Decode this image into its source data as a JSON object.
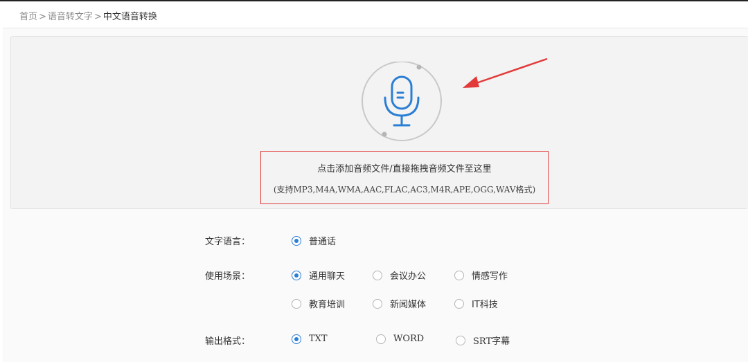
{
  "breadcrumb": {
    "items": [
      "首页",
      "语音转文字"
    ],
    "separator": ">",
    "current": "中文语音转换"
  },
  "upload": {
    "icon": "microphone-icon",
    "hint_main": "点击添加音频文件/直接拖拽音频文件至这里",
    "hint_formats": "(支持MP3,M4A,WMA,AAC,FLAC,AC3,M4R,APE,OGG,WAV格式)"
  },
  "form": {
    "language": {
      "label": "文字语言：",
      "options": [
        {
          "label": "普通话",
          "checked": true
        }
      ]
    },
    "scene": {
      "label": "使用场景：",
      "options": [
        {
          "label": "通用聊天",
          "checked": true
        },
        {
          "label": "会议办公",
          "checked": false
        },
        {
          "label": "情感写作",
          "checked": false
        },
        {
          "label": "教育培训",
          "checked": false
        },
        {
          "label": "新闻媒体",
          "checked": false
        },
        {
          "label": "IT科技",
          "checked": false
        }
      ]
    },
    "output": {
      "label": "输出格式：",
      "options": [
        {
          "label": "TXT",
          "checked": true
        },
        {
          "label": "WORD",
          "checked": false
        },
        {
          "label": "SRT字幕",
          "checked": false
        }
      ]
    }
  },
  "colors": {
    "accent": "#2a7fd4",
    "highlight": "#e23a3a",
    "zone_bg": "#f3f3f3"
  }
}
